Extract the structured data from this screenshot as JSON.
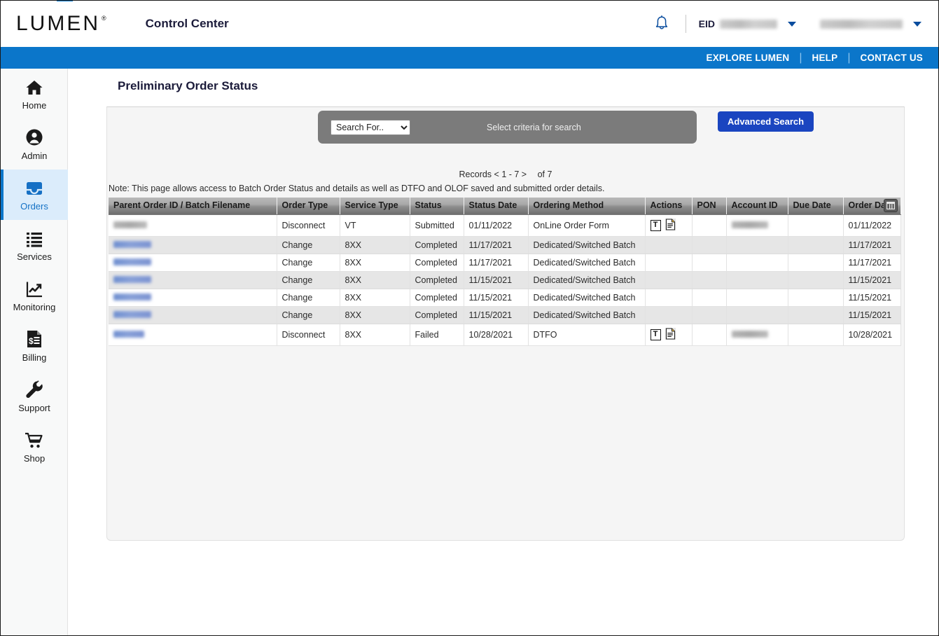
{
  "header": {
    "brand": "LUMEN",
    "brand_reg": "®",
    "app_title": "Control Center",
    "eid_label": "EID",
    "eid_value": "",
    "user_name": ""
  },
  "utility_nav": {
    "items": [
      {
        "label": "EXPLORE LUMEN"
      },
      {
        "label": "HELP"
      },
      {
        "label": "CONTACT US"
      }
    ],
    "separator": "|"
  },
  "sidebar": {
    "items": [
      {
        "label": "Home",
        "icon": "home-icon",
        "active": false
      },
      {
        "label": "Admin",
        "icon": "user-circle-icon",
        "active": false
      },
      {
        "label": "Orders",
        "icon": "inbox-icon",
        "active": true
      },
      {
        "label": "Services",
        "icon": "list-icon",
        "active": false
      },
      {
        "label": "Monitoring",
        "icon": "chart-line-icon",
        "active": false
      },
      {
        "label": "Billing",
        "icon": "invoice-icon",
        "active": false
      },
      {
        "label": "Support",
        "icon": "wrench-icon",
        "active": false
      },
      {
        "label": "Shop",
        "icon": "cart-icon",
        "active": false
      }
    ]
  },
  "page": {
    "title": "Preliminary Order Status"
  },
  "search": {
    "select_value": "Search For..",
    "select_options": [
      "Search For.."
    ],
    "criteria_text": "Select criteria for search",
    "advanced_button": "Advanced Search"
  },
  "records": {
    "prefix": "Records",
    "range": "< 1 - 7 >",
    "of_label": "of",
    "total": "7"
  },
  "note": "Note: This page allows access to Batch Order Status and details as well as DTFO and OLOF saved and submitted order details.",
  "table": {
    "columns": [
      "Parent Order ID / Batch Filename",
      "Order Type",
      "Service Type",
      "Status",
      "Status Date",
      "Ordering Method",
      "Actions",
      "PON",
      "Account ID",
      "Due Date",
      "Order Date"
    ],
    "column_chooser_icon": "table-grid-icon",
    "rows": [
      {
        "parent_order_id": "",
        "parent_order_id_redacted": true,
        "parent_order_id_style": "gray",
        "order_type": "Disconnect",
        "service_type": "VT",
        "status": "Submitted",
        "status_date": "01/11/2022",
        "ordering_method": "OnLine Order Form",
        "actions": [
          "text-icon",
          "document-icon"
        ],
        "pon": "",
        "account_id": "",
        "account_id_redacted": true,
        "due_date": "",
        "order_date": "01/11/2022"
      },
      {
        "parent_order_id": "",
        "parent_order_id_redacted": true,
        "parent_order_id_style": "blue",
        "order_type": "Change",
        "service_type": "8XX",
        "status": "Completed",
        "status_date": "11/17/2021",
        "ordering_method": "Dedicated/Switched Batch",
        "actions": [],
        "pon": "",
        "account_id": "",
        "account_id_redacted": false,
        "due_date": "",
        "order_date": "11/17/2021"
      },
      {
        "parent_order_id": "",
        "parent_order_id_redacted": true,
        "parent_order_id_style": "blue",
        "order_type": "Change",
        "service_type": "8XX",
        "status": "Completed",
        "status_date": "11/17/2021",
        "ordering_method": "Dedicated/Switched Batch",
        "actions": [],
        "pon": "",
        "account_id": "",
        "account_id_redacted": false,
        "due_date": "",
        "order_date": "11/17/2021"
      },
      {
        "parent_order_id": "",
        "parent_order_id_redacted": true,
        "parent_order_id_style": "blue",
        "order_type": "Change",
        "service_type": "8XX",
        "status": "Completed",
        "status_date": "11/15/2021",
        "ordering_method": "Dedicated/Switched Batch",
        "actions": [],
        "pon": "",
        "account_id": "",
        "account_id_redacted": false,
        "due_date": "",
        "order_date": "11/15/2021"
      },
      {
        "parent_order_id": "",
        "parent_order_id_redacted": true,
        "parent_order_id_style": "blue",
        "order_type": "Change",
        "service_type": "8XX",
        "status": "Completed",
        "status_date": "11/15/2021",
        "ordering_method": "Dedicated/Switched Batch",
        "actions": [],
        "pon": "",
        "account_id": "",
        "account_id_redacted": false,
        "due_date": "",
        "order_date": "11/15/2021"
      },
      {
        "parent_order_id": "",
        "parent_order_id_redacted": true,
        "parent_order_id_style": "blue",
        "order_type": "Change",
        "service_type": "8XX",
        "status": "Completed",
        "status_date": "11/15/2021",
        "ordering_method": "Dedicated/Switched Batch",
        "actions": [],
        "pon": "",
        "account_id": "",
        "account_id_redacted": false,
        "due_date": "",
        "order_date": "11/15/2021"
      },
      {
        "parent_order_id": "",
        "parent_order_id_redacted": true,
        "parent_order_id_style": "blue",
        "order_type": "Disconnect",
        "service_type": "8XX",
        "status": "Failed",
        "status_date": "10/28/2021",
        "ordering_method": "DTFO",
        "actions": [
          "text-icon",
          "document-icon"
        ],
        "pon": "",
        "account_id": "",
        "account_id_redacted": true,
        "due_date": "",
        "order_date": "10/28/2021"
      }
    ]
  },
  "colors": {
    "brand_blue": "#0b76ca",
    "accent_blue": "#1a45c0",
    "active_nav_bg": "#dbecfb",
    "panel_bg": "#f5f5f5",
    "search_pill": "#7b7b7b"
  }
}
